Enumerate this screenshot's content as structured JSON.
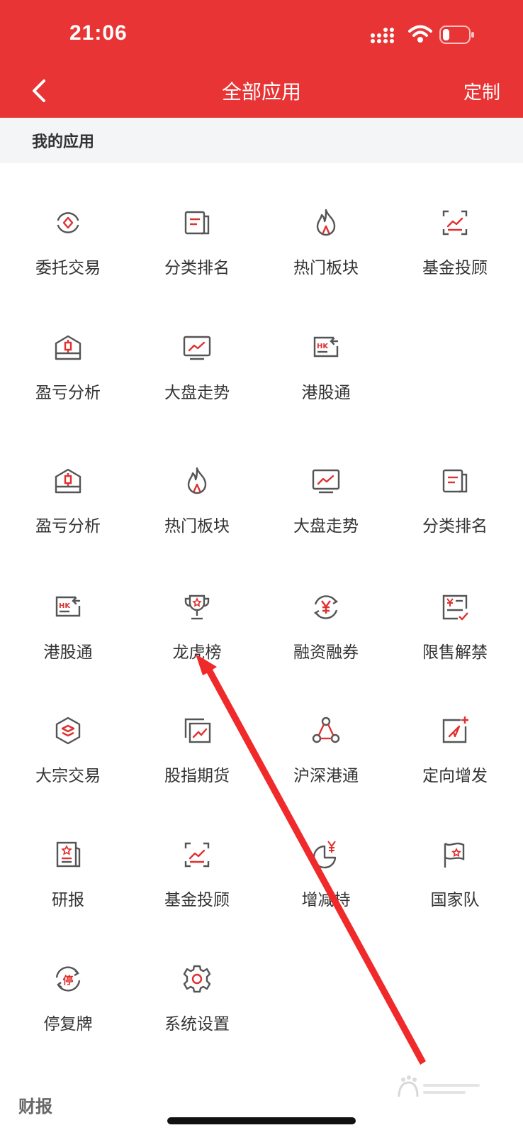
{
  "status_bar": {
    "time": "21:06"
  },
  "nav": {
    "title": "全部应用",
    "customize": "定制"
  },
  "section": {
    "title": "我的应用"
  },
  "rows": [
    [
      {
        "label": "委托交易",
        "icon": "entrust-trade-icon"
      },
      {
        "label": "分类排名",
        "icon": "category-ranking-icon"
      },
      {
        "label": "热门板块",
        "icon": "flame-icon"
      },
      {
        "label": "基金投顾",
        "icon": "fund-advisor-icon"
      }
    ],
    [
      {
        "label": "盈亏分析",
        "icon": "profit-loss-box-icon"
      },
      {
        "label": "大盘走势",
        "icon": "market-trend-monitor-icon"
      },
      {
        "label": "港股通",
        "icon": "hk-connect-icon"
      }
    ],
    [
      {
        "label": "盈亏分析",
        "icon": "profit-loss-box-icon"
      },
      {
        "label": "热门板块",
        "icon": "flame-icon"
      },
      {
        "label": "大盘走势",
        "icon": "market-trend-monitor-icon"
      },
      {
        "label": "分类排名",
        "icon": "category-ranking-icon"
      }
    ],
    [
      {
        "label": "港股通",
        "icon": "hk-connect-icon"
      },
      {
        "label": "龙虎榜",
        "icon": "trophy-icon"
      },
      {
        "label": "融资融券",
        "icon": "yen-cycle-icon"
      },
      {
        "label": "限售解禁",
        "icon": "yen-checklist-icon"
      }
    ],
    [
      {
        "label": "大宗交易",
        "icon": "layers-hexagon-icon"
      },
      {
        "label": "股指期货",
        "icon": "index-futures-icon"
      },
      {
        "label": "沪深港通",
        "icon": "triangle-nodes-icon"
      },
      {
        "label": "定向增发",
        "icon": "directed-issue-icon"
      }
    ],
    [
      {
        "label": "研报",
        "icon": "research-report-icon"
      },
      {
        "label": "基金投顾",
        "icon": "fund-advisor-icon"
      },
      {
        "label": "增减持",
        "icon": "yen-pie-icon"
      },
      {
        "label": "国家队",
        "icon": "flag-star-icon"
      }
    ],
    [
      {
        "label": "停复牌",
        "icon": "suspend-resume-icon"
      },
      {
        "label": "系统设置",
        "icon": "gear-icon"
      }
    ]
  ],
  "bottom": {
    "label": "财报"
  },
  "colors": {
    "brand_red": "#e83434",
    "icon_gray": "#555555",
    "accent_red": "#e03030"
  }
}
